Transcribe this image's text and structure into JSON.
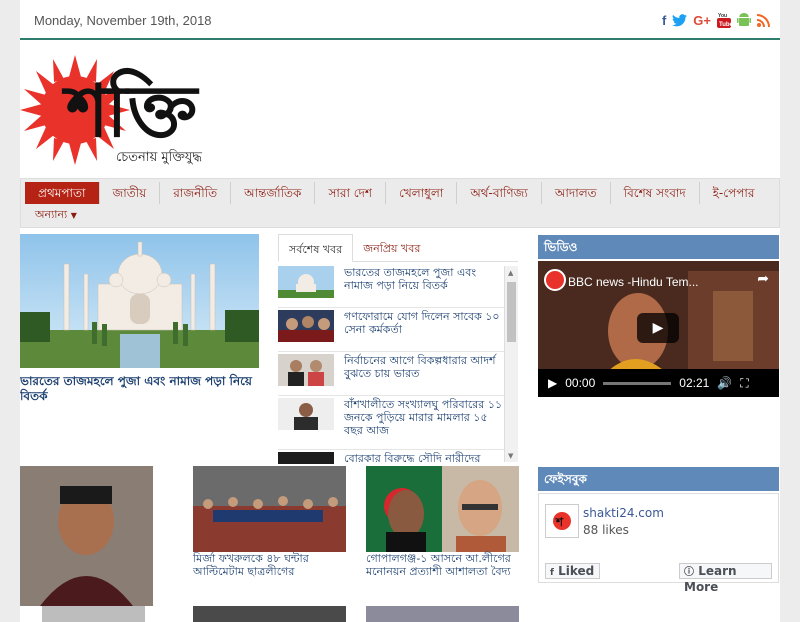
{
  "topbar": {
    "date": "Monday, November 19th, 2018",
    "social": [
      {
        "icon": "facebook-icon",
        "glyph": "f",
        "color": "#3b5998"
      },
      {
        "icon": "twitter-icon",
        "glyph": "🐦",
        "color": "#1da1f2"
      },
      {
        "icon": "google-plus-icon",
        "glyph": "G+",
        "color": "#dd4b39"
      },
      {
        "icon": "youtube-icon",
        "glyph": "▶",
        "color": "#cc181e"
      },
      {
        "icon": "android-icon",
        "glyph": "🤖",
        "color": "#78c257"
      },
      {
        "icon": "rss-icon",
        "glyph": "))",
        "color": "#f26522"
      }
    ]
  },
  "logo": {
    "text": "শক্তি",
    "tagline": "চেতনায় মুক্তিযুদ্ধ",
    "sun_color": "#e8322a"
  },
  "nav": {
    "items": [
      "প্রথমপাতা",
      "জাতীয়",
      "রাজনীতি",
      "আন্তর্জাতিক",
      "সারা দেশ",
      "খেলাধুলা",
      "অর্থ-বাণিজ্য",
      "আদালত",
      "বিশেষ সংবাদ",
      "ই-পেপার"
    ],
    "more": "অন্যান্য"
  },
  "featured": {
    "title": "ভারতের তাজমহলে পুজা এবং নামাজ পড়া নিয়ে বিতর্ক"
  },
  "tabs": {
    "latest": "সর্বশেষ খবর",
    "popular": "জনপ্রিয় খবর"
  },
  "news": [
    {
      "text": "ভারতের তাজমহলে পুজা এবং নামাজ পড়া নিয়ে বিতর্ক"
    },
    {
      "text": "গণফোরামে যোগ দিলেন সাবেক ১০ সেনা কর্মকর্তা"
    },
    {
      "text": "নির্বাচনের আগে বিকল্পধারার আদর্শ বুঝতে চায় ভারত"
    },
    {
      "text": "বাঁশখালীতে সংখ্যালঘু পরিবারের ১১ জনকে পুড়িয়ে মারার মামলার ১৫ বছর আজ"
    },
    {
      "text": "বোরকার বিরুদ্ধে সৌদি নারীদের"
    }
  ],
  "video": {
    "header": "ভিডিও",
    "title": "BBC news -Hindu Tem...",
    "current": "00:00",
    "duration": "02:21"
  },
  "facebook": {
    "header": "ফেইসবুক",
    "page": "shakti24.com",
    "likes": "88 likes",
    "liked": "Liked",
    "learn": "Learn More"
  },
  "cards": [
    {
      "text": ""
    },
    {
      "text": "মির্জা ফখরুলকে ৪৮ ঘন্টার আল্টিমেটাম ছাত্রলীগের"
    },
    {
      "text": "গোপালগঞ্জ-১ আসনে আ.লীগের মনোনয়ন প্রত্যাশী আশালতা বৈদ্য"
    }
  ]
}
